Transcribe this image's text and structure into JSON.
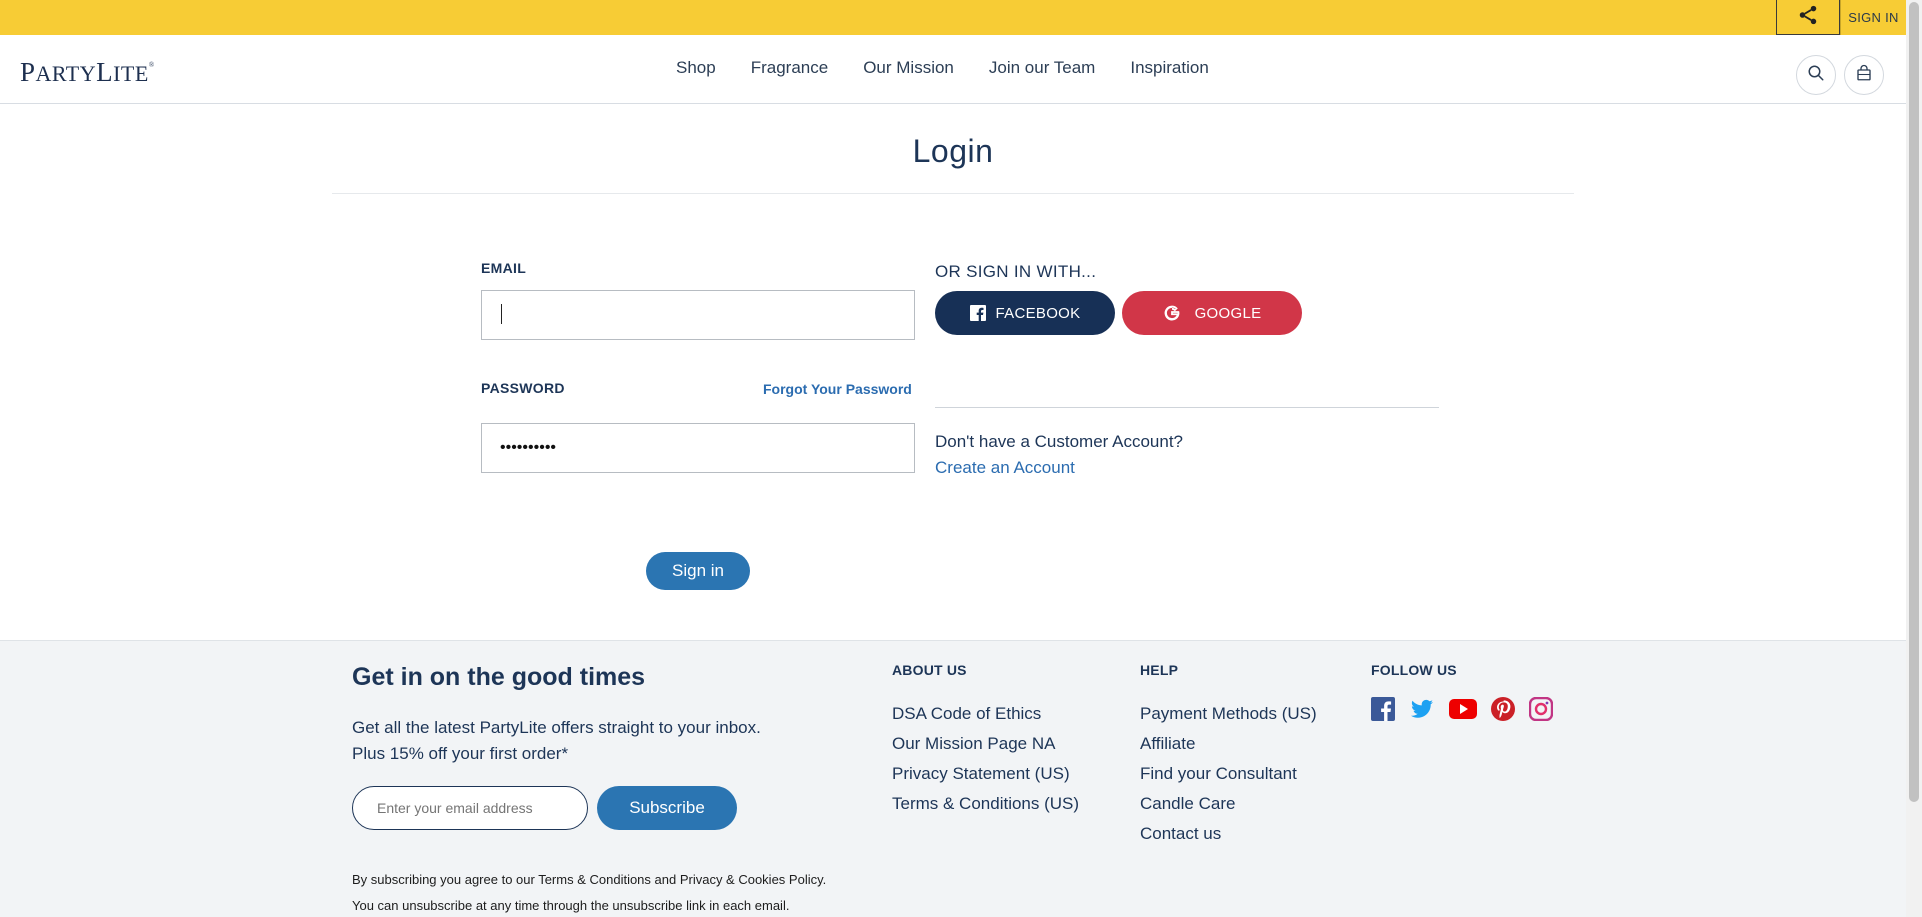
{
  "topbar": {
    "signin_label": "SIGN IN"
  },
  "header": {
    "logo_first": "P",
    "logo_mid": "ARTY",
    "logo_second": "L",
    "logo_end": "ITE",
    "nav": [
      {
        "label": "Shop"
      },
      {
        "label": "Fragrance"
      },
      {
        "label": "Our Mission"
      },
      {
        "label": "Join our Team"
      },
      {
        "label": "Inspiration"
      }
    ]
  },
  "login": {
    "title": "Login",
    "email_label": "EMAIL",
    "email_value": "",
    "password_label": "PASSWORD",
    "password_value": "••••••••••",
    "forgot_label": "Forgot Your Password",
    "or_sign_in": "OR SIGN IN WITH...",
    "facebook_label": "FACEBOOK",
    "google_label": "GOOGLE",
    "no_account": "Don't have a Customer Account?",
    "create_account": "Create an Account",
    "sign_in_button": "Sign in"
  },
  "footer": {
    "title": "Get in on the good times",
    "text_line1": "Get all the latest PartyLite offers straight to your inbox.",
    "text_line2": "Plus 15% off your first order*",
    "email_placeholder": "Enter your email address",
    "subscribe_label": "Subscribe",
    "legal_line1": "By subscribing you agree to our Terms & Conditions and Privacy & Cookies Policy.",
    "legal_line2": "You can unsubscribe at any time through the unsubscribe link in each email.",
    "about": {
      "heading": "ABOUT US",
      "links": [
        "DSA Code of Ethics",
        "Our Mission Page NA",
        "Privacy Statement (US)",
        "Terms & Conditions (US)"
      ]
    },
    "help": {
      "heading": "HELP",
      "links": [
        "Payment Methods (US)",
        "Affiliate",
        "Find your Consultant",
        "Candle Care",
        "Contact us"
      ]
    },
    "follow": {
      "heading": "FOLLOW US",
      "icons": [
        "facebook-icon",
        "twitter-icon",
        "youtube-icon",
        "pinterest-icon",
        "instagram-icon"
      ]
    }
  },
  "colors": {
    "topbar": "#f7cc35",
    "navy": "#1d3557",
    "link_blue": "#2b6cb0",
    "button_blue": "#2b75b2",
    "facebook": "#173056",
    "google": "#d13648",
    "footer_bg": "#f2f4f6"
  }
}
